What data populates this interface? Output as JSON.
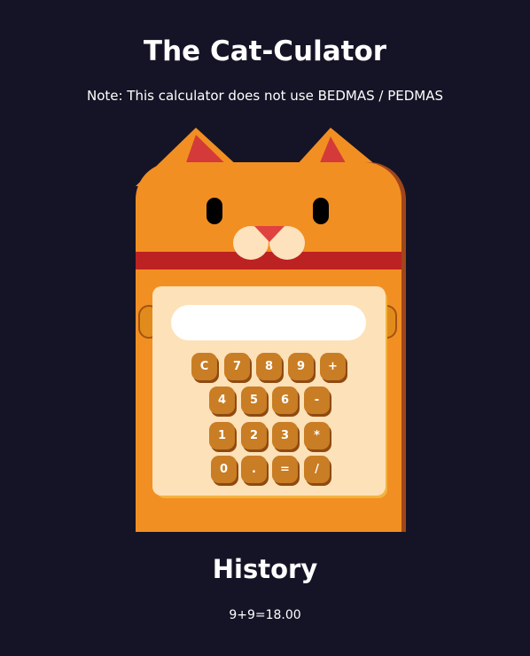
{
  "header": {
    "title": "The Cat-Culator",
    "note": "Note: This calculator does not use BEDMAS / PEDMAS"
  },
  "display": {
    "value": "",
    "placeholder": ""
  },
  "keys": [
    {
      "label": "C"
    },
    {
      "label": "7"
    },
    {
      "label": "8"
    },
    {
      "label": "9"
    },
    {
      "label": "+"
    },
    {
      "label": "4"
    },
    {
      "label": "5"
    },
    {
      "label": "6"
    },
    {
      "label": "-"
    },
    {
      "label": "1"
    },
    {
      "label": "2"
    },
    {
      "label": "3"
    },
    {
      "label": "*"
    },
    {
      "label": "0"
    },
    {
      "label": "."
    },
    {
      "label": "="
    },
    {
      "label": "/"
    }
  ],
  "history": {
    "title": "History",
    "entries": [
      "9+9=18.00"
    ]
  },
  "colors": {
    "background": "#151426",
    "cat_body": "#f28f22",
    "cat_ear_inner": "#d43a3a",
    "collar": "#bd2222",
    "panel": "#fde1b8",
    "key": "#c97d24"
  }
}
